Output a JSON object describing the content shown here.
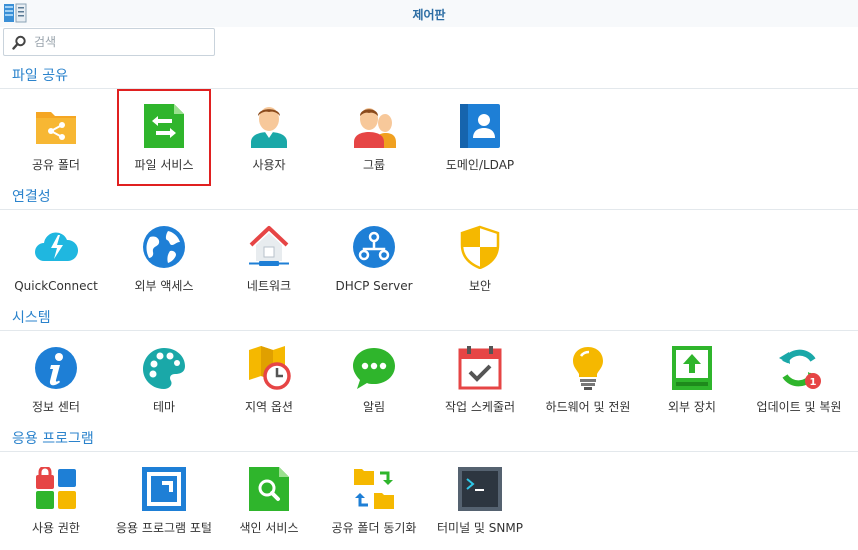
{
  "window": {
    "title": "제어판"
  },
  "search": {
    "placeholder": "검색"
  },
  "sections": [
    {
      "header": "파일 공유",
      "items": [
        {
          "label": "공유 폴더",
          "icon": "shared-folder-icon"
        },
        {
          "label": "파일 서비스",
          "icon": "file-services-icon",
          "highlighted": true
        },
        {
          "label": "사용자",
          "icon": "user-icon"
        },
        {
          "label": "그룹",
          "icon": "group-icon"
        },
        {
          "label": "도메인/LDAP",
          "icon": "domain-ldap-icon"
        }
      ]
    },
    {
      "header": "연결성",
      "items": [
        {
          "label": "QuickConnect",
          "icon": "quickconnect-icon"
        },
        {
          "label": "외부 액세스",
          "icon": "external-access-icon"
        },
        {
          "label": "네트워크",
          "icon": "network-icon"
        },
        {
          "label": "DHCP Server",
          "icon": "dhcp-server-icon"
        },
        {
          "label": "보안",
          "icon": "security-shield-icon"
        }
      ]
    },
    {
      "header": "시스템",
      "items": [
        {
          "label": "정보 센터",
          "icon": "info-center-icon"
        },
        {
          "label": "테마",
          "icon": "theme-palette-icon"
        },
        {
          "label": "지역 옵션",
          "icon": "regional-options-icon"
        },
        {
          "label": "알림",
          "icon": "notification-icon"
        },
        {
          "label": "작업 스케줄러",
          "icon": "task-scheduler-icon"
        },
        {
          "label": "하드웨어 및 전원",
          "icon": "hardware-power-icon"
        },
        {
          "label": "외부 장치",
          "icon": "external-devices-icon"
        },
        {
          "label": "업데이트 및 복원",
          "icon": "update-restore-icon",
          "badge": "1"
        }
      ]
    },
    {
      "header": "응용 프로그램",
      "items": [
        {
          "label": "사용 권한",
          "icon": "privileges-icon"
        },
        {
          "label": "응용 프로그램 포털",
          "icon": "application-portal-icon"
        },
        {
          "label": "색인 서비스",
          "icon": "indexing-service-icon"
        },
        {
          "label": "공유 폴더 동기화",
          "icon": "shared-folder-sync-icon"
        },
        {
          "label": "터미널 및 SNMP",
          "icon": "terminal-snmp-icon"
        }
      ]
    }
  ],
  "colors": {
    "accent": "#2b83cc",
    "highlight": "#e02020"
  }
}
